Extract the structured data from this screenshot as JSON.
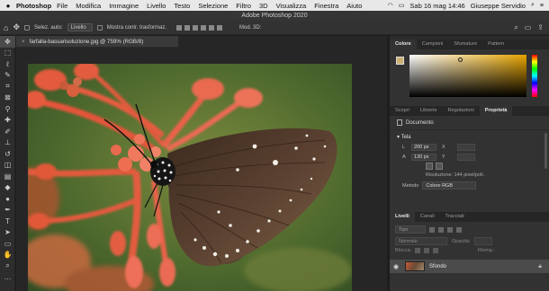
{
  "menubar": {
    "apple": "",
    "app": "Photoshop",
    "items": [
      "File",
      "Modifica",
      "Immagine",
      "Livello",
      "Testo",
      "Selezione",
      "Filtro",
      "3D",
      "Visualizza",
      "Finestra",
      "Aiuto"
    ],
    "datetime": "Sab 16 mag 14:46",
    "user": "Giuseppe Servidio"
  },
  "window": {
    "title": "Adobe Photoshop 2020"
  },
  "options": {
    "autoselect": "Selez. auto:",
    "autoselect_value": "Livello",
    "transform": "Mostra contr. trasformaz.",
    "mode3d": "Mod. 3D:"
  },
  "document": {
    "tab_title": "farfalla-bassarisoluzione.jpg @ 759% (RGB/8)",
    "close": "×"
  },
  "color_panel": {
    "tabs": [
      "Colore",
      "Campioni",
      "Sfumature",
      "Pattern"
    ],
    "foreground": "#cdb070",
    "background": "#ffffff"
  },
  "properties_panel": {
    "tabs": [
      "Scopri",
      "Librerie",
      "Regolazioni",
      "Proprietà"
    ],
    "doc_label": "Documento",
    "section": "Tela",
    "width_label": "L",
    "width_value": "200 px",
    "x_label": "X",
    "height_label": "A",
    "height_value": "130 px",
    "y_label": "Y",
    "resolution": "Risoluzione: 144 pixel/poll.",
    "metodo_label": "Metodo",
    "metodo_value": "Colore RGB"
  },
  "layers_panel": {
    "tabs": [
      "Livelli",
      "Canali",
      "Tracciati"
    ],
    "search_placeholder": "Tipo",
    "blend": "Normale",
    "opacity_label": "Opacità:",
    "lock_label": "Blocca:",
    "fill_label": "Riemp.:",
    "layer_name": "Sfondo"
  }
}
